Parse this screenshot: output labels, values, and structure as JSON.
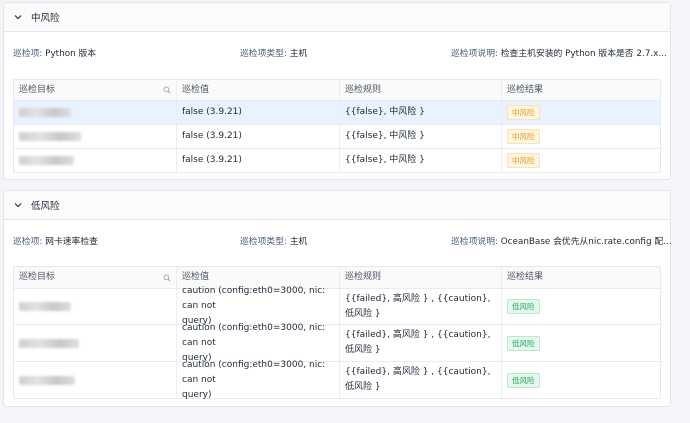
{
  "sections": [
    {
      "title": "中风险",
      "item_key": "巡检项:",
      "item_val": "Python 版本",
      "type_key": "巡检项类型:",
      "type_val": "主机",
      "desc_key": "巡检项说明:",
      "desc_val": "检查主机安装的 Python 版本是否 2.7.x...",
      "headers": [
        "巡检目标",
        "巡检值",
        "巡检规则",
        "巡检结果"
      ],
      "rows": [
        {
          "value": "false (3.9.21)",
          "rule": "{{false}, 中风险 }",
          "result": "中风险"
        },
        {
          "value": "false (3.9.21)",
          "rule": "{{false}, 中风险 }",
          "result": "中风险"
        },
        {
          "value": "false (3.9.21)",
          "rule": "{{false}, 中风险 }",
          "result": "中风险"
        }
      ]
    },
    {
      "title": "低风险",
      "item_key": "巡检项:",
      "item_val": "网卡速率检查",
      "type_key": "巡检项类型:",
      "type_val": "主机",
      "desc_key": "巡检项说明:",
      "desc_val": "OceanBase 会优先从nic.rate.config 配...",
      "headers": [
        "巡检目标",
        "巡检值",
        "巡检规则",
        "巡检结果"
      ],
      "rows": [
        {
          "value_l1": "caution (config:eth0=3000, nic: can not",
          "value_l2": "query)",
          "rule": "{{failed}, 高风险 } , {{caution}, 低风险 }",
          "result": "低风险"
        },
        {
          "value_l1": "caution (config:eth0=3000, nic: can not",
          "value_l2": "query)",
          "rule": "{{failed}, 高风险 } , {{caution}, 低风险 }",
          "result": "低风险"
        },
        {
          "value_l1": "caution (config:eth0=3000, nic: can not",
          "value_l2": "query)",
          "rule": "{{failed}, 高风险 } , {{caution}, 低风险 }",
          "result": "低风险"
        }
      ]
    }
  ],
  "icons": {
    "chevron": "chevron-down-icon",
    "search": "search-icon"
  }
}
